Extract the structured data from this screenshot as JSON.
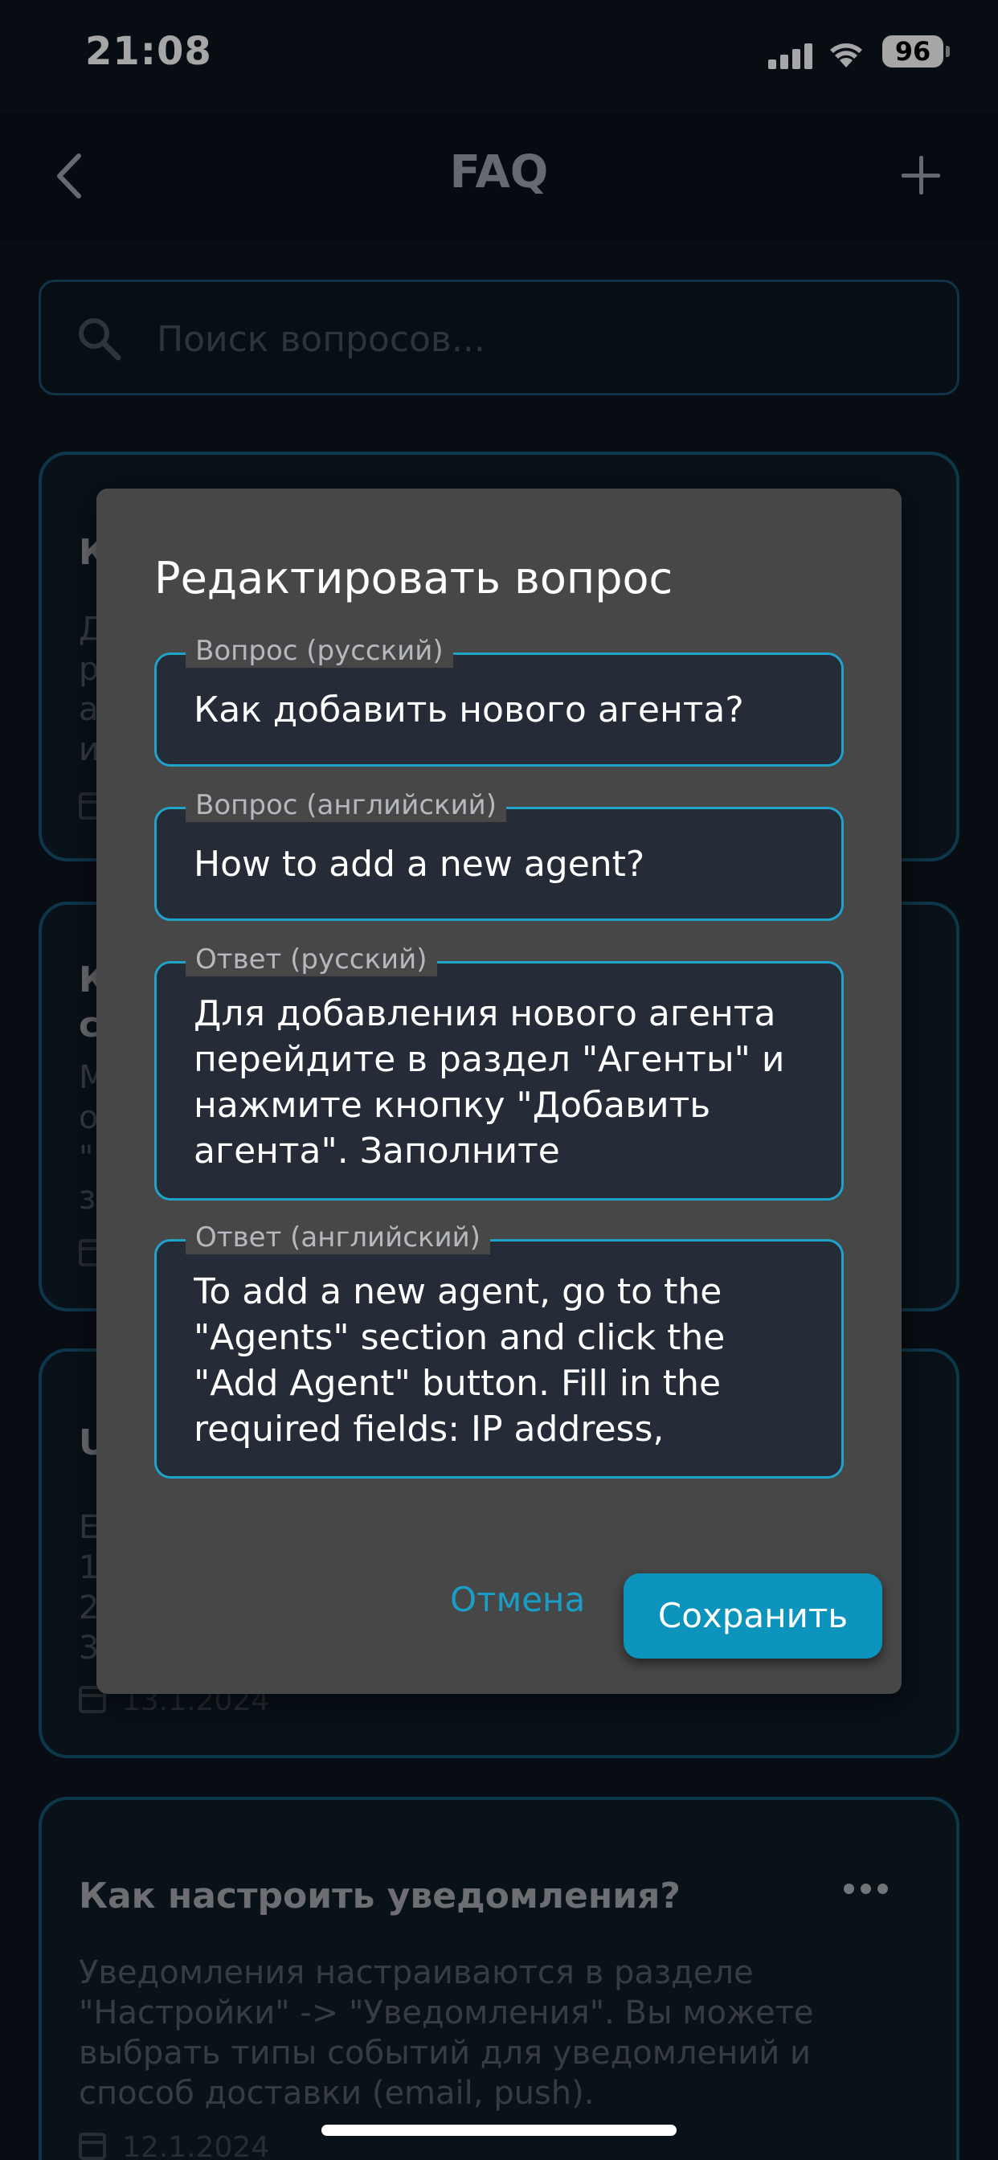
{
  "status_bar": {
    "time": "21:08",
    "battery": "96"
  },
  "app_bar": {
    "title": "FAQ"
  },
  "search": {
    "placeholder": "Поиск вопросов..."
  },
  "cards": [
    {
      "title_fragment": "К",
      "body_fragment": "Д\nр\nа\nи"
    },
    {
      "title_fragment": "К\nс",
      "body_fragment": "М\nо\n\"\nз"
    },
    {
      "title_fragment": "U",
      "body_fragment": "E\n1.\n2.\n3.",
      "date": "13.1.2024"
    },
    {
      "title": "Как настроить уведомления?",
      "body": "Уведомления настраиваются в разделе \"Настройки\" -> \"Уведомления\". Вы можете выбрать типы событий для уведомлений и способ доставки (email, push).",
      "date": "12.1.2024"
    }
  ],
  "card_ellipsis": "...",
  "modal": {
    "title": "Редактировать вопрос",
    "fields": [
      {
        "label": "Вопрос (русский)",
        "value": "Как добавить нового агента?"
      },
      {
        "label": "Вопрос (английский)",
        "value": "How to add a new agent?"
      },
      {
        "label": "Ответ (русский)",
        "value": "Для добавления нового агента перейдите в раздел \"Агенты\" и нажмите кнопку \"Добавить агента\". Заполните"
      },
      {
        "label": "Ответ (английский)",
        "value": "To add a new agent, go to the \"Agents\" section and click the \"Add Agent\" button. Fill in the required fields: IP address,"
      }
    ],
    "cancel_label": "Отмена",
    "save_label": "Сохранить"
  },
  "colors": {
    "accent": "#0d94bc",
    "field_border": "#1fa4c9",
    "modal_bg": "#474747",
    "background": "#0d1420"
  },
  "icons": [
    "back-chevron-icon",
    "plus-icon",
    "search-icon",
    "calendar-icon",
    "more-horizontal-icon",
    "signal-icon",
    "wifi-icon",
    "battery-icon"
  ]
}
